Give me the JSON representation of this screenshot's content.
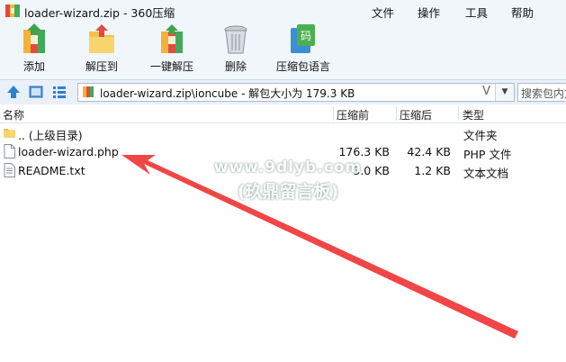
{
  "window": {
    "title": "loader-wizard.zip - 360压缩",
    "app_icon": "archive-icon"
  },
  "menu": [
    {
      "label": "文件"
    },
    {
      "label": "操作"
    },
    {
      "label": "工具"
    },
    {
      "label": "帮助"
    }
  ],
  "toolbar": [
    {
      "label": "添加",
      "icon": "add-archive-icon"
    },
    {
      "label": "解压到",
      "icon": "extract-to-icon"
    },
    {
      "label": "一键解压",
      "icon": "one-click-extract-icon"
    },
    {
      "label": "删除",
      "icon": "trash-icon"
    },
    {
      "label": "压缩包语言",
      "icon": "archive-language-icon",
      "badge": "码"
    }
  ],
  "address": {
    "path": "loader-wizard.zip\\ioncube - 解包大小为 179.3 KB",
    "v_label": "V",
    "search_placeholder": "搜索包内文"
  },
  "columns": {
    "name": "名称",
    "compressed": "压缩前",
    "packed": "压缩后",
    "type": "类型"
  },
  "files": [
    {
      "name": ".. (上级目录)",
      "compressed": "",
      "packed": "",
      "type": "文件夹",
      "icon": "folder-icon"
    },
    {
      "name": "loader-wizard.php",
      "compressed": "176.3 KB",
      "packed": "42.4 KB",
      "type": "PHP 文件",
      "icon": "file-icon"
    },
    {
      "name": "README.txt",
      "compressed": "3.0 KB",
      "packed": "1.2 KB",
      "type": "文本文档",
      "icon": "text-file-icon"
    }
  ],
  "watermark": {
    "line1": "www.9dlyb.com",
    "line2": "(玖鼎留言板)"
  },
  "colors": {
    "chrome_bg": "#f1f6fb",
    "address_bg": "#e9f0f8",
    "arrow": "#f04646",
    "folder": "#f2c14e"
  }
}
